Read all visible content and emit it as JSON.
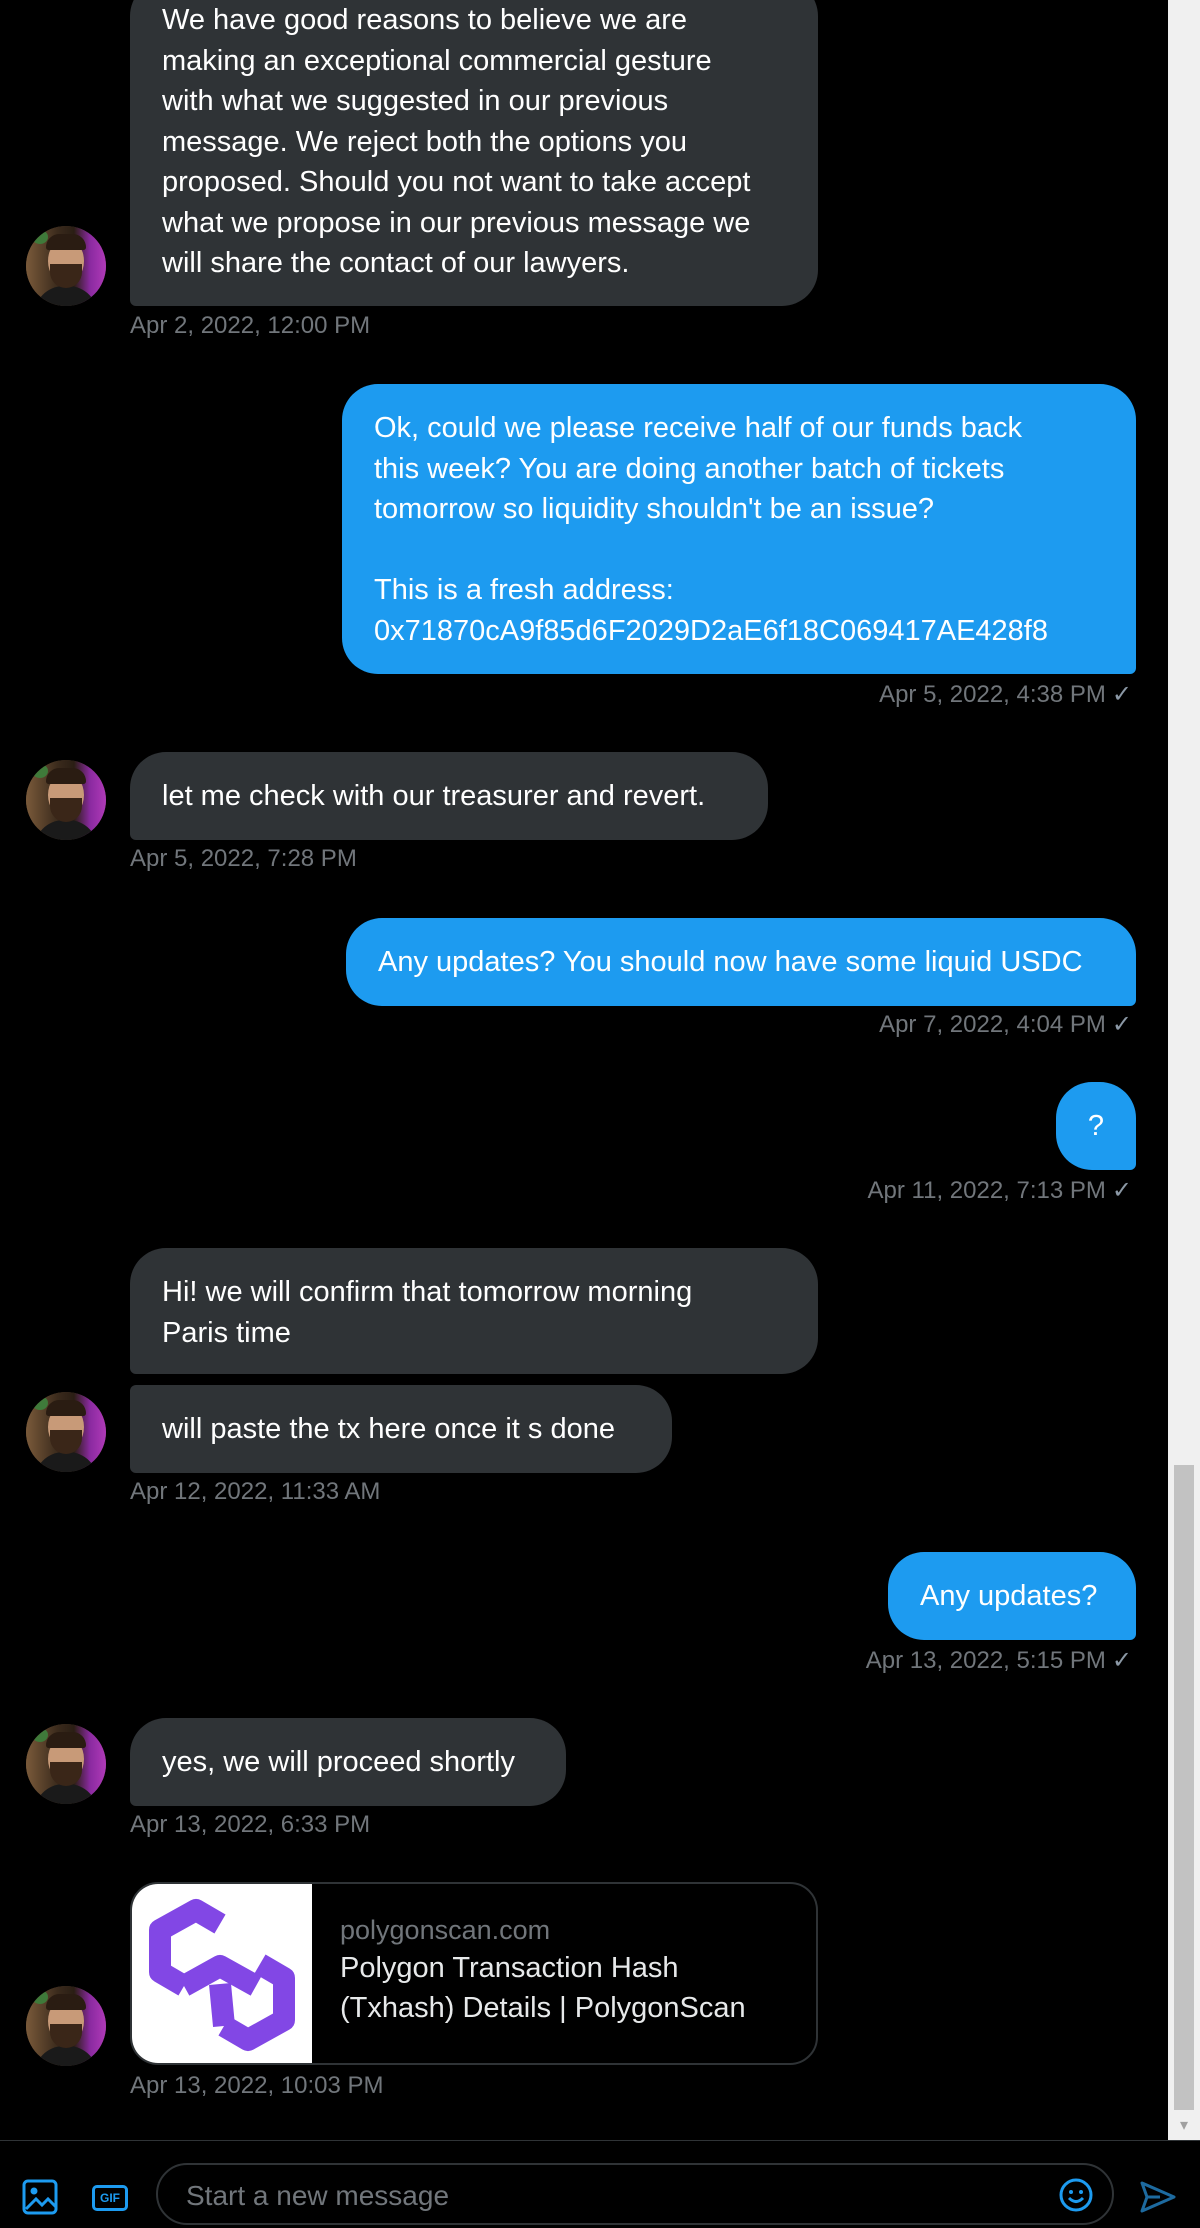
{
  "messages": [
    {
      "type": "in",
      "lines": [
        "We have good reasons to believe we are",
        "making an exceptional commercial gesture",
        "with what we suggested in our previous",
        "message. We reject both the options you",
        "proposed. Should you not want to take accept",
        "what we propose in our previous message we",
        "will share the contact of our lawyers."
      ],
      "time": "Apr 2, 2022, 12:00 PM"
    },
    {
      "type": "out",
      "lines": [
        "Ok, could we please receive half of our funds back",
        "this week? You are doing another batch of tickets",
        "tomorrow so liquidity shouldn't be an issue?",
        "",
        "This is a fresh address:",
        "0x71870cA9f85d6F2029D2aE6f18C069417AE428f8"
      ],
      "time": "Apr 5, 2022, 4:38 PM"
    },
    {
      "type": "in",
      "lines": [
        "let me check with our treasurer and revert."
      ],
      "time": "Apr 5, 2022, 7:28 PM"
    },
    {
      "type": "out",
      "lines": [
        "Any updates? You should now have some liquid USDC"
      ],
      "time": "Apr 7, 2022, 4:04 PM"
    },
    {
      "type": "out",
      "lines": [
        "?"
      ],
      "time": "Apr 11, 2022, 7:13 PM"
    },
    {
      "type": "in",
      "lines": [
        "Hi! we will confirm that tomorrow morning",
        "Paris time"
      ]
    },
    {
      "type": "in",
      "lines": [
        "will paste the tx here once it s done"
      ],
      "time": "Apr 12, 2022, 11:33 AM"
    },
    {
      "type": "out",
      "lines": [
        "Any updates?"
      ],
      "time": "Apr 13, 2022, 5:15 PM"
    },
    {
      "type": "in",
      "lines": [
        "yes, we will proceed shortly"
      ],
      "time": "Apr 13, 2022, 6:33 PM"
    }
  ],
  "link_card": {
    "domain": "polygonscan.com",
    "title_line1": "Polygon Transaction Hash",
    "title_line2": "(Txhash) Details | PolygonScan",
    "time": "Apr 13, 2022, 10:03 PM"
  },
  "composer": {
    "placeholder": "Start a new message",
    "gif_label": "GIF"
  },
  "colors": {
    "incoming_bubble": "#2f3336",
    "outgoing_bubble": "#1d9bf0",
    "polygon_purple": "#8247e5"
  },
  "icons": [
    "image-icon",
    "gif-icon",
    "emoji-icon",
    "send-icon",
    "sent-check-icon",
    "polygon-logo",
    "scroll-down-arrow-icon"
  ]
}
